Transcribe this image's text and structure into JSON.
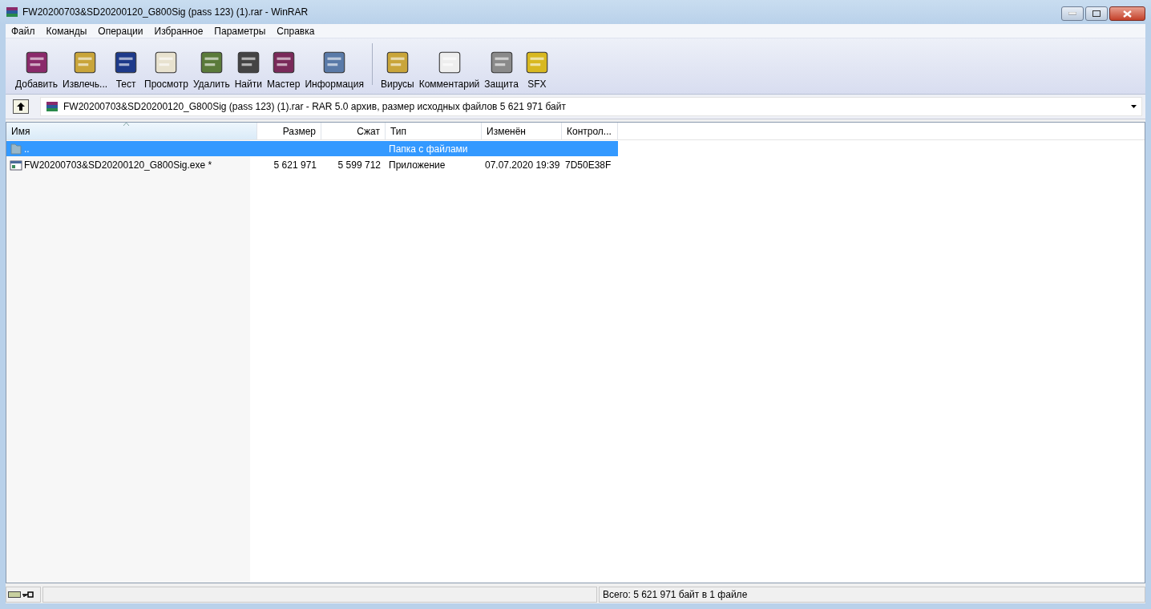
{
  "window": {
    "title": "FW20200703&SD20200120_G800Sig (pass 123) (1).rar - WinRAR"
  },
  "menu": [
    "Файл",
    "Команды",
    "Операции",
    "Избранное",
    "Параметры",
    "Справка"
  ],
  "toolbar": [
    {
      "label": "Добавить"
    },
    {
      "label": "Извлечь..."
    },
    {
      "label": "Тест"
    },
    {
      "label": "Просмотр"
    },
    {
      "label": "Удалить"
    },
    {
      "label": "Найти"
    },
    {
      "label": "Мастер"
    },
    {
      "label": "Информация"
    },
    {
      "label": "Вирусы"
    },
    {
      "label": "Комментарий"
    },
    {
      "label": "Защита"
    },
    {
      "label": "SFX"
    }
  ],
  "address": {
    "value": "FW20200703&SD20200120_G800Sig (pass 123) (1).rar - RAR 5.0 архив, размер исходных файлов 5 621 971 байт"
  },
  "table": {
    "columns": [
      {
        "label": "Имя",
        "sorted": true
      },
      {
        "label": "Размер",
        "sorted": false
      },
      {
        "label": "Сжат",
        "sorted": false
      },
      {
        "label": "Тип",
        "sorted": false
      },
      {
        "label": "Изменён",
        "sorted": false
      },
      {
        "label": "Контрол...",
        "sorted": false
      }
    ],
    "rows": [
      {
        "kind": "folder",
        "selected": true,
        "cells": [
          "..",
          "",
          "",
          "Папка с файлами",
          "",
          ""
        ]
      },
      {
        "kind": "file",
        "selected": false,
        "cells": [
          "FW20200703&SD20200120_G800Sig.exe *",
          "5 621 971",
          "5 599 712",
          "Приложение",
          "07.07.2020 19:39",
          "7D50E38F"
        ]
      }
    ]
  },
  "status_bar": {
    "text": "Всего: 5 621 971 байт в 1 файле"
  }
}
